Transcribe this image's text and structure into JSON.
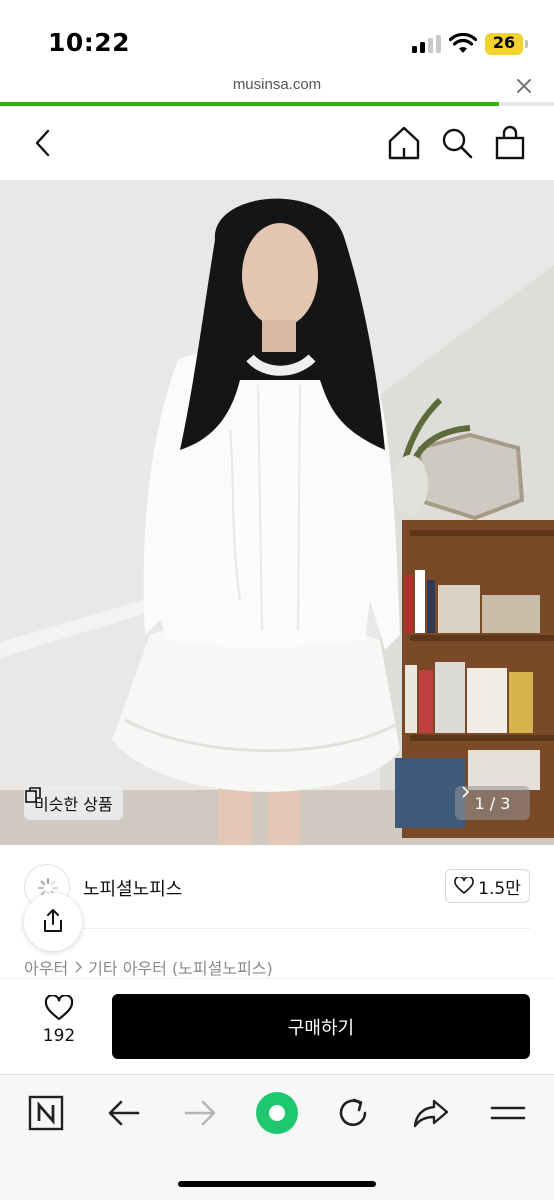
{
  "status_bar": {
    "time": "10:22",
    "battery": "26",
    "battery_color": "#f2d22c"
  },
  "browser": {
    "url": "musinsa.com",
    "close_icon": "close-icon",
    "progress": 0.9,
    "progress_color": "#2db400"
  },
  "header": {
    "icons": [
      "chevron-left-icon",
      "home-icon",
      "search-icon",
      "shopping-bag-icon"
    ]
  },
  "product_image": {
    "similar_label": "비슷한 상품",
    "page_indicator": "1 / 3"
  },
  "brand": {
    "name": "노피셜노피스",
    "like_count": "1.5만"
  },
  "breadcrumb": {
    "items": [
      "아우터",
      "기타 아우터 (노피셜노피스)"
    ]
  },
  "purchase": {
    "wish_count": "192",
    "buy_label": "구매하기",
    "buy_color": "#000000"
  },
  "toolbar": {
    "icons": [
      "naver-n-icon",
      "back-arrow-icon",
      "forward-arrow-icon",
      "green-dot-icon",
      "reload-icon",
      "share-arrow-icon",
      "menu-icon"
    ],
    "accent": "#1ec86e"
  }
}
